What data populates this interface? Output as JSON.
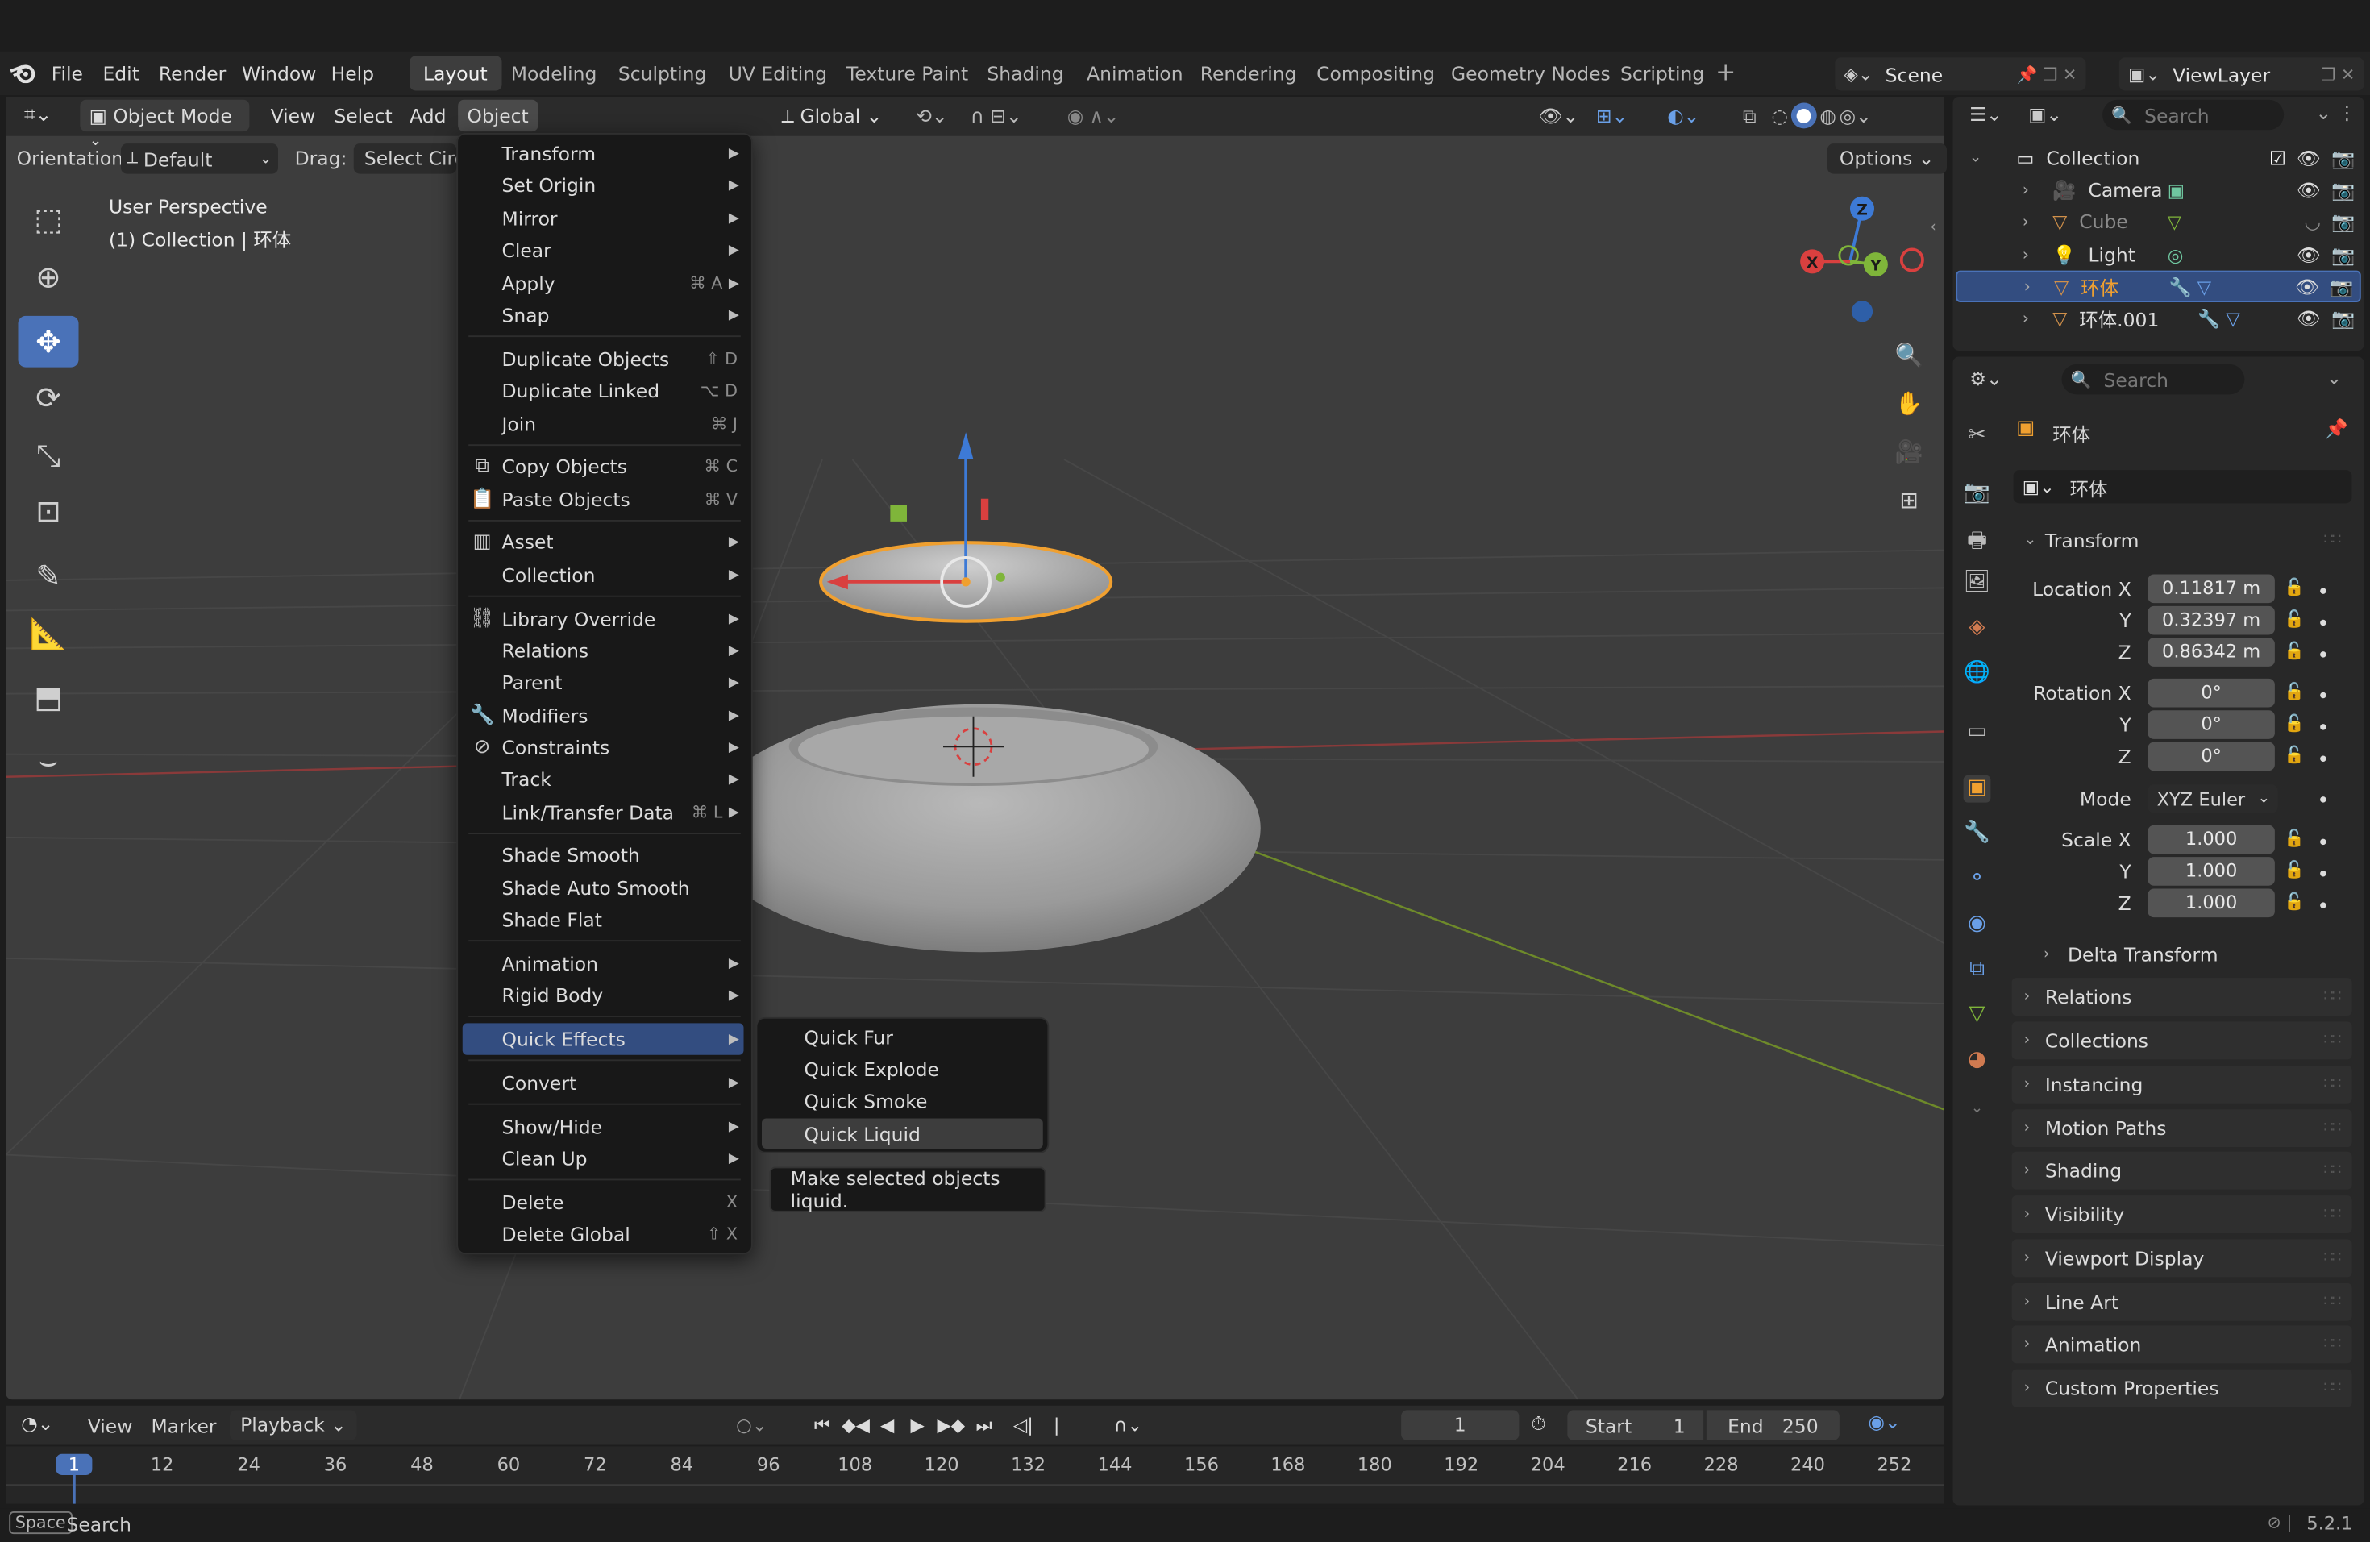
{
  "menubar": {
    "items": [
      "File",
      "Edit",
      "Render",
      "Window",
      "Help"
    ],
    "workspaces": [
      "Layout",
      "Modeling",
      "Sculpting",
      "UV Editing",
      "Texture Paint",
      "Shading",
      "Animation",
      "Rendering",
      "Compositing",
      "Geometry Nodes",
      "Scripting"
    ],
    "active_workspace": "Layout",
    "scene": "Scene",
    "view_layer": "ViewLayer"
  },
  "viewport_header": {
    "mode": "Object Mode",
    "menus": [
      "View",
      "Select",
      "Add",
      "Object"
    ],
    "transform_orientation": "Global"
  },
  "tool_settings": {
    "orientation_label": "Orientation:",
    "orientation_value": "Default",
    "drag_label": "Drag:",
    "drag_value": "Select Circ",
    "options": "Options"
  },
  "viewport_info": {
    "line1": "User Perspective",
    "line2": "(1) Collection | 环体"
  },
  "gizmo": {
    "x": "X",
    "y": "Y",
    "z": "Z"
  },
  "object_menu": {
    "items": [
      {
        "label": "Transform",
        "shortcut": "",
        "submenu": true,
        "icon": ""
      },
      {
        "label": "Set Origin",
        "shortcut": "",
        "submenu": true,
        "icon": ""
      },
      {
        "label": "Mirror",
        "shortcut": "",
        "submenu": true,
        "icon": ""
      },
      {
        "label": "Clear",
        "shortcut": "",
        "submenu": true,
        "icon": ""
      },
      {
        "label": "Apply",
        "shortcut": "⌘ A",
        "submenu": true,
        "icon": ""
      },
      {
        "label": "Snap",
        "shortcut": "",
        "submenu": true,
        "icon": ""
      },
      {
        "label": "Duplicate Objects",
        "shortcut": "⇧ D",
        "submenu": false,
        "icon": ""
      },
      {
        "label": "Duplicate Linked",
        "shortcut": "⌥ D",
        "submenu": false,
        "icon": ""
      },
      {
        "label": "Join",
        "shortcut": "⌘ J",
        "submenu": false,
        "icon": ""
      },
      {
        "label": "Copy Objects",
        "shortcut": "⌘ C",
        "submenu": false,
        "icon": "copy-icon"
      },
      {
        "label": "Paste Objects",
        "shortcut": "⌘ V",
        "submenu": false,
        "icon": "paste-icon"
      },
      {
        "label": "Asset",
        "shortcut": "",
        "submenu": true,
        "icon": "asset-icon"
      },
      {
        "label": "Collection",
        "shortcut": "",
        "submenu": true,
        "icon": ""
      },
      {
        "label": "Library Override",
        "shortcut": "",
        "submenu": true,
        "icon": "library-override-icon"
      },
      {
        "label": "Relations",
        "shortcut": "",
        "submenu": true,
        "icon": ""
      },
      {
        "label": "Parent",
        "shortcut": "",
        "submenu": true,
        "icon": ""
      },
      {
        "label": "Modifiers",
        "shortcut": "",
        "submenu": true,
        "icon": "wrench-icon"
      },
      {
        "label": "Constraints",
        "shortcut": "",
        "submenu": true,
        "icon": "constraint-icon"
      },
      {
        "label": "Track",
        "shortcut": "",
        "submenu": true,
        "icon": ""
      },
      {
        "label": "Link/Transfer Data",
        "shortcut": "⌘ L",
        "submenu": true,
        "icon": ""
      },
      {
        "label": "Shade Smooth",
        "shortcut": "",
        "submenu": false,
        "icon": ""
      },
      {
        "label": "Shade Auto Smooth",
        "shortcut": "",
        "submenu": false,
        "icon": ""
      },
      {
        "label": "Shade Flat",
        "shortcut": "",
        "submenu": false,
        "icon": ""
      },
      {
        "label": "Animation",
        "shortcut": "",
        "submenu": true,
        "icon": ""
      },
      {
        "label": "Rigid Body",
        "shortcut": "",
        "submenu": true,
        "icon": ""
      },
      {
        "label": "Quick Effects",
        "shortcut": "",
        "submenu": true,
        "icon": ""
      },
      {
        "label": "Convert",
        "shortcut": "",
        "submenu": true,
        "icon": ""
      },
      {
        "label": "Show/Hide",
        "shortcut": "",
        "submenu": true,
        "icon": ""
      },
      {
        "label": "Clean Up",
        "shortcut": "",
        "submenu": true,
        "icon": ""
      },
      {
        "label": "Delete",
        "shortcut": "X",
        "submenu": false,
        "icon": ""
      },
      {
        "label": "Delete Global",
        "shortcut": "⇧ X",
        "submenu": false,
        "icon": ""
      }
    ]
  },
  "quick_effects_submenu": {
    "items": [
      "Quick Fur",
      "Quick Explode",
      "Quick Smoke",
      "Quick Liquid"
    ],
    "highlighted": "Quick Liquid",
    "tooltip": "Make selected objects liquid."
  },
  "outliner": {
    "search_placeholder": "Search",
    "collection": "Collection",
    "objects": [
      {
        "name": "Camera",
        "dimmed": false,
        "selected": false
      },
      {
        "name": "Cube",
        "dimmed": true,
        "selected": false
      },
      {
        "name": "Light",
        "dimmed": false,
        "selected": false
      },
      {
        "name": "环体",
        "dimmed": false,
        "selected": true
      },
      {
        "name": "环体.001",
        "dimmed": false,
        "selected": false
      }
    ]
  },
  "properties": {
    "search_placeholder": "Search",
    "object_name": "环体",
    "object_name_field": "环体",
    "transform_title": "Transform",
    "location": {
      "label": "Location X",
      "x": "0.11817 m",
      "y": "0.32397 m",
      "z": "0.86342 m"
    },
    "rotation": {
      "label": "Rotation X",
      "x": "0°",
      "y": "0°",
      "z": "0°"
    },
    "mode_label": "Mode",
    "mode_value": "XYZ Euler",
    "scale": {
      "label": "Scale X",
      "x": "1.000",
      "y": "1.000",
      "z": "1.000"
    },
    "axis_y": "Y",
    "axis_z": "Z",
    "delta_transform": "Delta Transform",
    "panels": [
      "Relations",
      "Collections",
      "Instancing",
      "Motion Paths",
      "Shading",
      "Visibility",
      "Viewport Display",
      "Line Art",
      "Animation",
      "Custom Properties"
    ]
  },
  "timeline": {
    "menus": [
      "View",
      "Marker",
      "Playback"
    ],
    "current_frame": "1",
    "start_label": "Start",
    "start_value": "1",
    "end_label": "End",
    "end_value": "250",
    "ticks": [
      "1",
      "12",
      "24",
      "36",
      "48",
      "60",
      "72",
      "84",
      "96",
      "108",
      "120",
      "132",
      "144",
      "156",
      "168",
      "180",
      "192",
      "204",
      "216",
      "228",
      "240",
      "252"
    ]
  },
  "statusbar": {
    "key": "Space",
    "action": "Search",
    "version": "5.2.1"
  },
  "colors": {
    "accent_blue": "#4a72b8",
    "selection_orange": "#f0a030",
    "x_axis": "#d9403f",
    "y_axis": "#7fb53a",
    "z_axis": "#3d7ad6"
  }
}
